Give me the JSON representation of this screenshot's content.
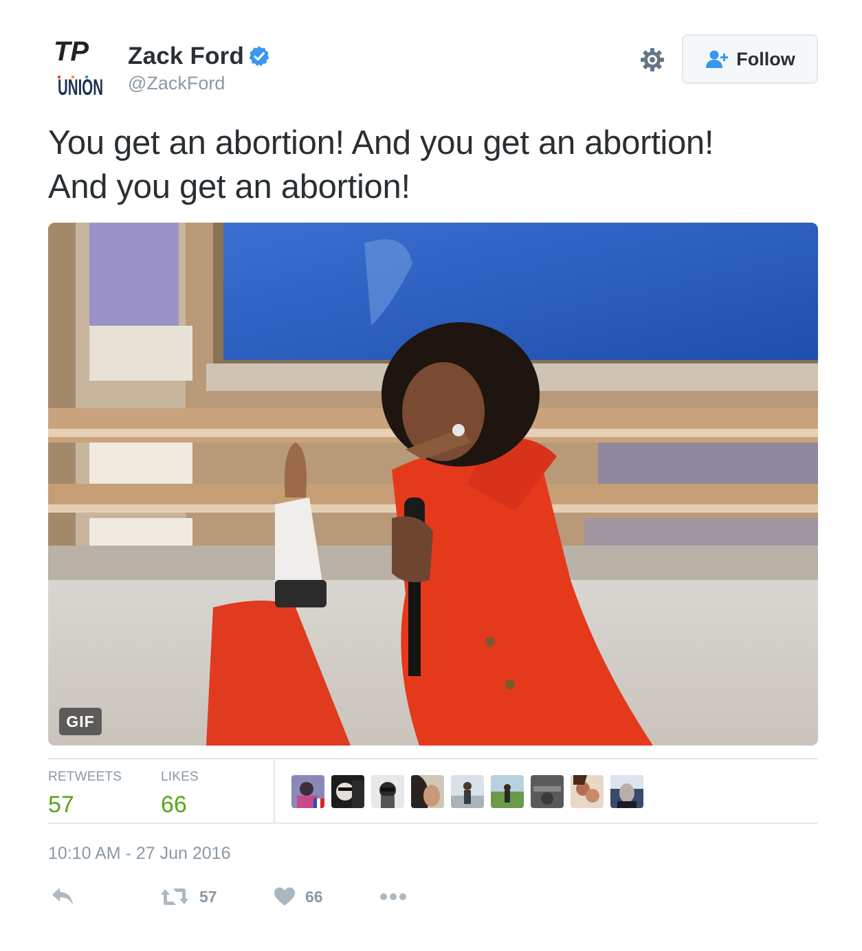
{
  "author": {
    "name": "Zack Ford",
    "handle": "@ZackFord",
    "avatar_text_top": "TP",
    "avatar_text_bottom": "UNION",
    "verified": true
  },
  "header": {
    "follow_label": "Follow"
  },
  "tweet": {
    "text_line1": "You get an abortion! And you get an abortion!",
    "text_line2": "And you get an abortion!",
    "media_badge": "GIF"
  },
  "stats": {
    "retweets_label": "RETWEETS",
    "retweets_value": "57",
    "likes_label": "LIKES",
    "likes_value": "66"
  },
  "timestamp": "10:10 AM - 27 Jun 2016",
  "actions": {
    "retweet_count": "57",
    "like_count": "66"
  },
  "colors": {
    "text": "#292f33",
    "muted": "#8899a6",
    "verified_blue": "#3897f0",
    "count_green": "#5aa51a",
    "border": "#e1e8ed"
  }
}
